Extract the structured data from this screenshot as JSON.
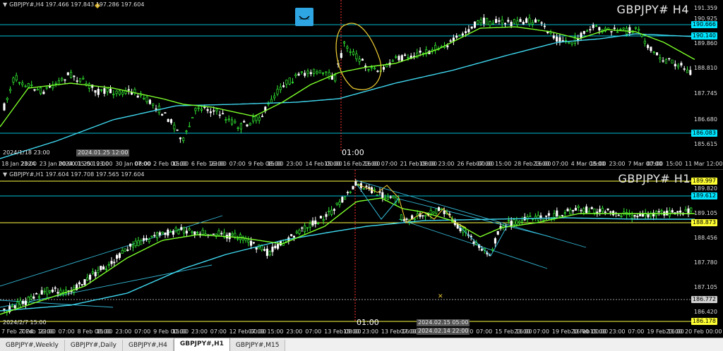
{
  "top_pane": {
    "header_text": "GBPJPY#,H4  197.466 197.843 197.286 197.604",
    "title": "GBPJPY# H4",
    "price_labels": [
      "191.359",
      "190.925",
      "189.860",
      "188.810",
      "187.745",
      "186.680",
      "185.615"
    ],
    "tags": [
      {
        "value": "190.666",
        "color": "#00e5ff"
      },
      {
        "value": "190.140",
        "color": "#00e5ff"
      },
      {
        "value": "186.083",
        "color": "#00e5ff"
      }
    ],
    "time_labels": [
      "18 Jan 2024",
      "23:00",
      "23 Jan 00:00",
      "2024.01.25 19:00",
      "15:00",
      "23:00",
      "30 Jan 08:00",
      "07:00",
      "2 Feb 00:00",
      "15:00",
      "6 Feb 16:00",
      "23:00",
      "07:00",
      "9 Feb 08:00",
      "15:00",
      "23:00",
      "14 Feb 00:00",
      "15:00",
      "16 Feb 16:00",
      "23:00",
      "07:00",
      "21 Feb 08:00",
      "15:00",
      "23:00",
      "26 Feb 00:00",
      "07:00",
      "15:00",
      "28 Feb 16:00",
      "23:00",
      "07:00",
      "4 Mar 08:00",
      "15:00",
      "23:00",
      "7 Mar 00:00",
      "07:00",
      "15:00",
      "11 Mar 12:00"
    ],
    "time_tags": [
      "2024.01.25 12:00",
      "2024/1/18 23:00"
    ],
    "cursor_time": "01:00"
  },
  "bottom_pane": {
    "header_text": "GBPJPY#,H1  197.604 197.708 197.565 197.604",
    "title": "GBPJPY# H1",
    "price_labels": [
      "189.820",
      "189.105",
      "188.456",
      "187.780",
      "187.105",
      "186.420"
    ],
    "tags": [
      {
        "value": "189.997",
        "color": "#ffff33"
      },
      {
        "value": "189.612",
        "color": "#00e5ff"
      },
      {
        "value": "188.873",
        "color": "#ffff33"
      },
      {
        "value": "186.772",
        "color": "#cfcfcf"
      },
      {
        "value": "186.178",
        "color": "#ffff33"
      }
    ],
    "time_labels": [
      "7 Feb 2024",
      "7 Feb 16:00",
      "23:00",
      "07:00",
      "8 Feb 08:00",
      "15:00",
      "23:00",
      "07:00",
      "9 Feb 00:00",
      "15:00",
      "23:00",
      "07:00",
      "12 Feb 00:00",
      "07:00",
      "15:00",
      "23:00",
      "07:00",
      "13 Feb 08:00",
      "15:00",
      "23:00",
      "13 Feb 16:00",
      "07:00",
      "14 Feb 00:00",
      "15:00",
      "23:00",
      "07:00",
      "15 Feb 16:00",
      "23:00",
      "07:00",
      "19 Feb 16:00",
      "20 Feb 00:00",
      "15:00",
      "23:00",
      "07:00",
      "19 Feb 16:00",
      "23:00",
      "20 Feb 00:00"
    ],
    "time_tags": [
      "2024.02.15 05:00",
      "2024.02.14 22:00",
      "2024/2/7 15:00"
    ],
    "cursor_time": "01:00"
  },
  "tabs": [
    {
      "label": "GBPJPY#,Weekly",
      "active": false
    },
    {
      "label": "GBPJPY#,Daily",
      "active": false
    },
    {
      "label": "GBPJPY#,H4",
      "active": false
    },
    {
      "label": "GBPJPY#,H1",
      "active": true
    },
    {
      "label": "GBPJPY#,M15",
      "active": false
    }
  ],
  "colors": {
    "bull": "#33ee33",
    "bear": "#ffffff",
    "ma_fast": "#7cff2a",
    "ma_slow": "#3fd8f0",
    "hline_cyan": "#00bcd4",
    "hline_yellow": "#ffff44",
    "annot": "#e6c632",
    "vline": "#ff3333"
  }
}
